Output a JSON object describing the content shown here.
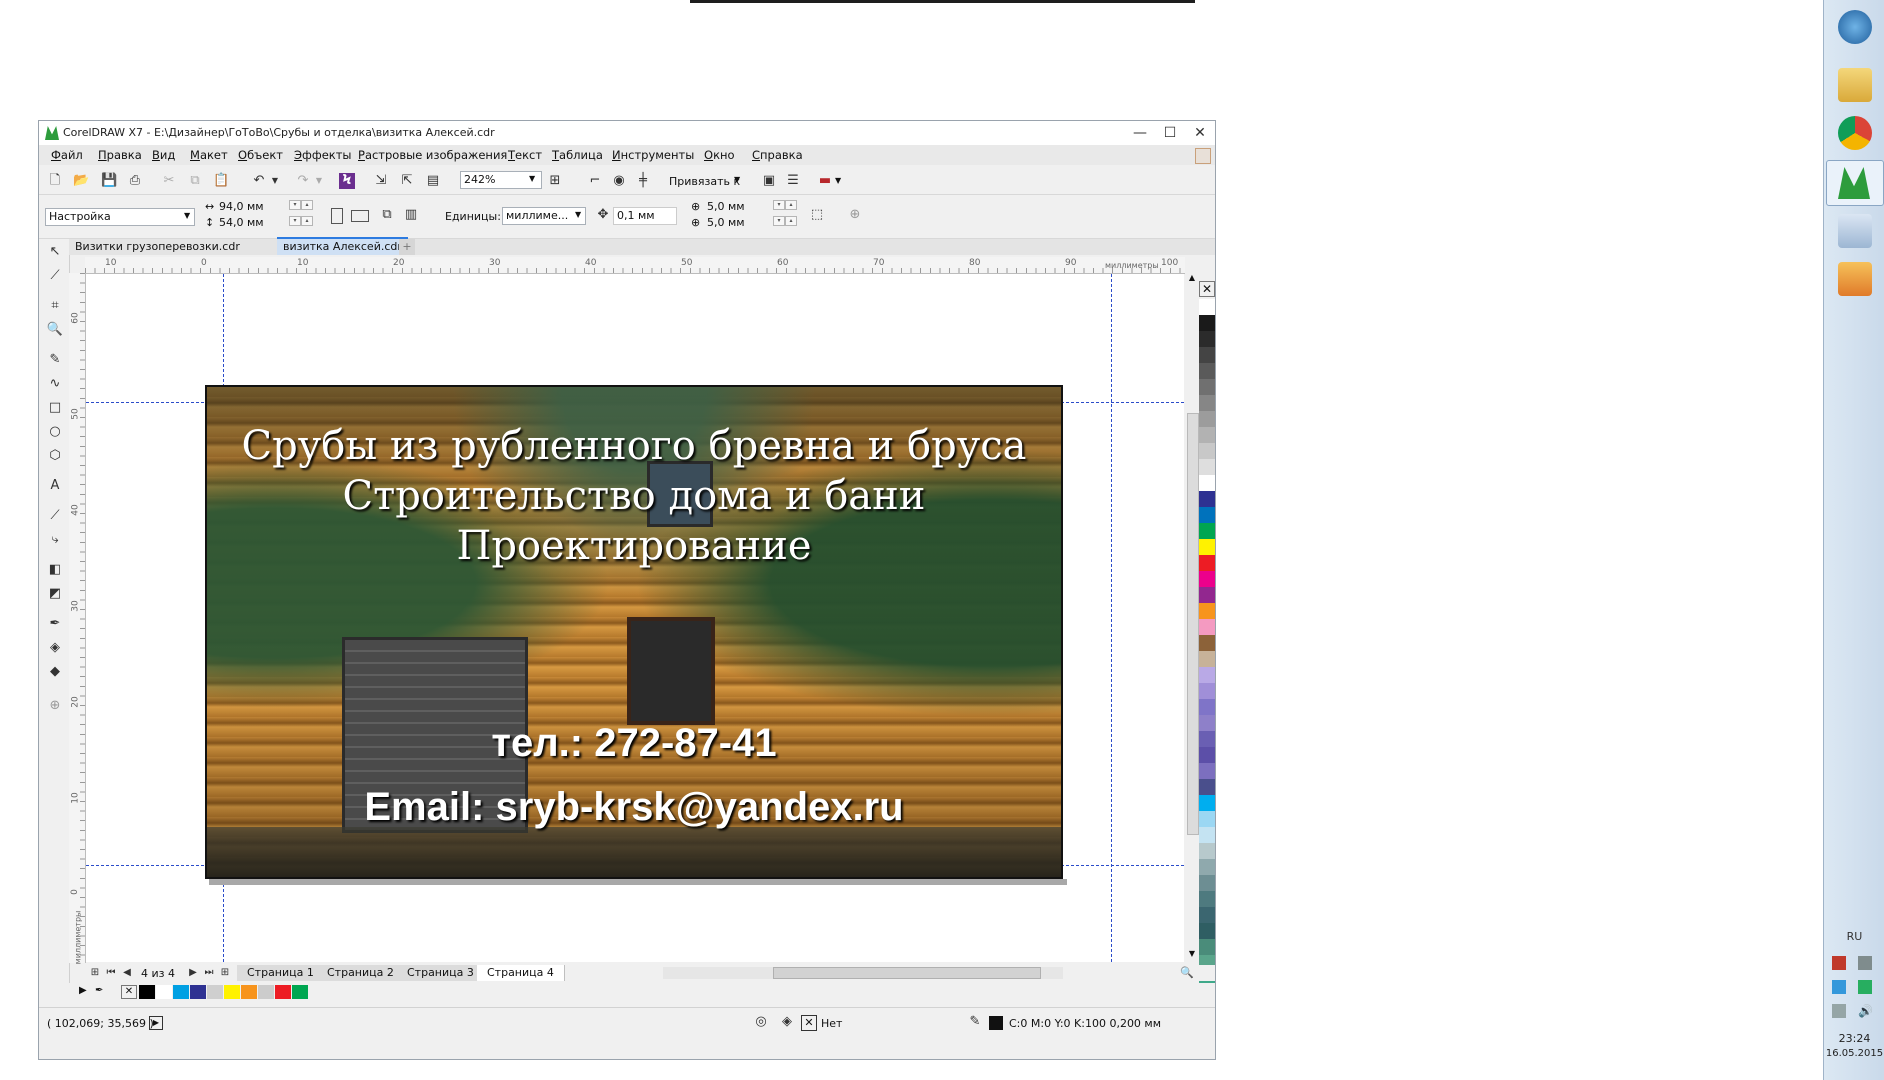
{
  "window": {
    "title": "CorelDRAW X7 - E:\\Дизайнер\\ГоТоВо\\Срубы и отделка\\визитка Алексей.cdr",
    "controls": [
      "—",
      "☐",
      "✕"
    ]
  },
  "menu": [
    "Файл",
    "Правка",
    "Вид",
    "Макет",
    "Объект",
    "Эффекты",
    "Растровые изображения",
    "Текст",
    "Таблица",
    "Инструменты",
    "Окно",
    "Справка"
  ],
  "toolbar": {
    "zoom": "242%",
    "snap_label": "Привязать к"
  },
  "property_bar": {
    "preset": "Настройка",
    "width": "94,0 мм",
    "height": "54,0 мм",
    "units_label": "Единицы:",
    "units_value": "миллиме...",
    "nudge": "0,1 мм",
    "dup_x": "5,0 мм",
    "dup_y": "5,0 мм"
  },
  "doc_tabs": [
    "Визитки грузоперевозки.cdr",
    "визитка Алексей.cdr"
  ],
  "ruler": {
    "h_ticks": [
      "10",
      "0",
      "10",
      "20",
      "30",
      "40",
      "50",
      "60",
      "70",
      "80",
      "90",
      "100"
    ],
    "h_unit": "миллиметры",
    "v_ticks": [
      "60",
      "50",
      "40",
      "30",
      "20",
      "10",
      "0"
    ],
    "v_unit": "миллиметры"
  },
  "card": {
    "line1": "Срубы из рубленного бревна и бруса",
    "line2": "Строительство дома и бани",
    "line3": "Проектирование",
    "phone": "тел.: 272-87-41",
    "email": "Email: sryb-krsk@yandex.ru"
  },
  "pages": {
    "counter": "4 из 4",
    "tabs": [
      "Страница 1",
      "Страница 2",
      "Страница 3",
      "Страница 4"
    ],
    "active": "Страница 4"
  },
  "status": {
    "coords": "( 102,069; 35,569 )",
    "fill_label": "Нет",
    "outline": "C:0 M:0 Y:0 K:100  0,200 мм"
  },
  "palette": [
    "#ffffff",
    "#1a1a1a",
    "#2b2b2b",
    "#444444",
    "#5a5a5a",
    "#707070",
    "#868686",
    "#9c9c9c",
    "#b2b2b2",
    "#c8c8c8",
    "#dedede",
    "#ffffff",
    "#2e3192",
    "#0072bc",
    "#00a651",
    "#fff200",
    "#ed1c24",
    "#ec008c",
    "#92278f",
    "#f7941d",
    "#f49ac1",
    "#8c6239",
    "#c7b299",
    "#b9a9e6",
    "#a08fd8",
    "#7f74c8",
    "#8e80c9",
    "#6a5fb3",
    "#5c4fa8",
    "#7c6fbf",
    "#4a4f8c",
    "#00aeef",
    "#9bd7f3",
    "#c4e3f2",
    "#b7c9cc",
    "#8fa9ad",
    "#6d8e93",
    "#4e7a7f",
    "#3b6670",
    "#2f5e63",
    "#4a8c7a",
    "#5aa58b",
    "#3fa98a"
  ],
  "doc_palette": [
    "#000000",
    "#ffffff",
    "#00a0e3",
    "#2e3192",
    "#cfcfcf",
    "#fff200",
    "#f7941d",
    "#cccccc",
    "#ed1c24",
    "#00a651"
  ],
  "taskbar": {
    "lang": "RU",
    "time": "23:24",
    "date": "16.05.2015"
  }
}
